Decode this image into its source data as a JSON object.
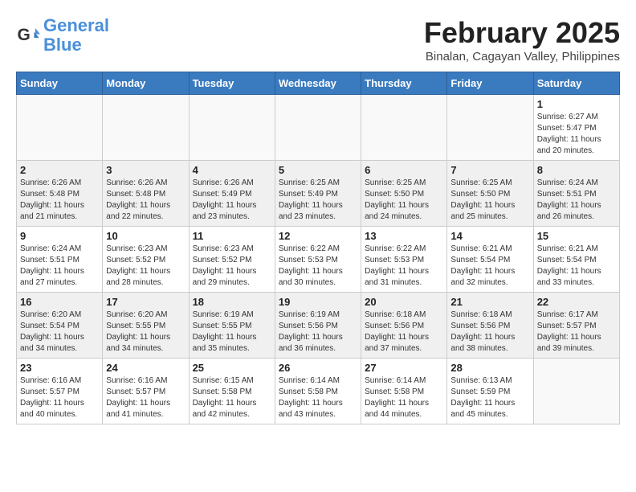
{
  "header": {
    "logo_line1": "General",
    "logo_line2": "Blue",
    "month_title": "February 2025",
    "location": "Binalan, Cagayan Valley, Philippines"
  },
  "days_of_week": [
    "Sunday",
    "Monday",
    "Tuesday",
    "Wednesday",
    "Thursday",
    "Friday",
    "Saturday"
  ],
  "weeks": [
    [
      {
        "day": "",
        "info": ""
      },
      {
        "day": "",
        "info": ""
      },
      {
        "day": "",
        "info": ""
      },
      {
        "day": "",
        "info": ""
      },
      {
        "day": "",
        "info": ""
      },
      {
        "day": "",
        "info": ""
      },
      {
        "day": "1",
        "info": "Sunrise: 6:27 AM\nSunset: 5:47 PM\nDaylight: 11 hours\nand 20 minutes."
      }
    ],
    [
      {
        "day": "2",
        "info": "Sunrise: 6:26 AM\nSunset: 5:48 PM\nDaylight: 11 hours\nand 21 minutes."
      },
      {
        "day": "3",
        "info": "Sunrise: 6:26 AM\nSunset: 5:48 PM\nDaylight: 11 hours\nand 22 minutes."
      },
      {
        "day": "4",
        "info": "Sunrise: 6:26 AM\nSunset: 5:49 PM\nDaylight: 11 hours\nand 23 minutes."
      },
      {
        "day": "5",
        "info": "Sunrise: 6:25 AM\nSunset: 5:49 PM\nDaylight: 11 hours\nand 23 minutes."
      },
      {
        "day": "6",
        "info": "Sunrise: 6:25 AM\nSunset: 5:50 PM\nDaylight: 11 hours\nand 24 minutes."
      },
      {
        "day": "7",
        "info": "Sunrise: 6:25 AM\nSunset: 5:50 PM\nDaylight: 11 hours\nand 25 minutes."
      },
      {
        "day": "8",
        "info": "Sunrise: 6:24 AM\nSunset: 5:51 PM\nDaylight: 11 hours\nand 26 minutes."
      }
    ],
    [
      {
        "day": "9",
        "info": "Sunrise: 6:24 AM\nSunset: 5:51 PM\nDaylight: 11 hours\nand 27 minutes."
      },
      {
        "day": "10",
        "info": "Sunrise: 6:23 AM\nSunset: 5:52 PM\nDaylight: 11 hours\nand 28 minutes."
      },
      {
        "day": "11",
        "info": "Sunrise: 6:23 AM\nSunset: 5:52 PM\nDaylight: 11 hours\nand 29 minutes."
      },
      {
        "day": "12",
        "info": "Sunrise: 6:22 AM\nSunset: 5:53 PM\nDaylight: 11 hours\nand 30 minutes."
      },
      {
        "day": "13",
        "info": "Sunrise: 6:22 AM\nSunset: 5:53 PM\nDaylight: 11 hours\nand 31 minutes."
      },
      {
        "day": "14",
        "info": "Sunrise: 6:21 AM\nSunset: 5:54 PM\nDaylight: 11 hours\nand 32 minutes."
      },
      {
        "day": "15",
        "info": "Sunrise: 6:21 AM\nSunset: 5:54 PM\nDaylight: 11 hours\nand 33 minutes."
      }
    ],
    [
      {
        "day": "16",
        "info": "Sunrise: 6:20 AM\nSunset: 5:54 PM\nDaylight: 11 hours\nand 34 minutes."
      },
      {
        "day": "17",
        "info": "Sunrise: 6:20 AM\nSunset: 5:55 PM\nDaylight: 11 hours\nand 34 minutes."
      },
      {
        "day": "18",
        "info": "Sunrise: 6:19 AM\nSunset: 5:55 PM\nDaylight: 11 hours\nand 35 minutes."
      },
      {
        "day": "19",
        "info": "Sunrise: 6:19 AM\nSunset: 5:56 PM\nDaylight: 11 hours\nand 36 minutes."
      },
      {
        "day": "20",
        "info": "Sunrise: 6:18 AM\nSunset: 5:56 PM\nDaylight: 11 hours\nand 37 minutes."
      },
      {
        "day": "21",
        "info": "Sunrise: 6:18 AM\nSunset: 5:56 PM\nDaylight: 11 hours\nand 38 minutes."
      },
      {
        "day": "22",
        "info": "Sunrise: 6:17 AM\nSunset: 5:57 PM\nDaylight: 11 hours\nand 39 minutes."
      }
    ],
    [
      {
        "day": "23",
        "info": "Sunrise: 6:16 AM\nSunset: 5:57 PM\nDaylight: 11 hours\nand 40 minutes."
      },
      {
        "day": "24",
        "info": "Sunrise: 6:16 AM\nSunset: 5:57 PM\nDaylight: 11 hours\nand 41 minutes."
      },
      {
        "day": "25",
        "info": "Sunrise: 6:15 AM\nSunset: 5:58 PM\nDaylight: 11 hours\nand 42 minutes."
      },
      {
        "day": "26",
        "info": "Sunrise: 6:14 AM\nSunset: 5:58 PM\nDaylight: 11 hours\nand 43 minutes."
      },
      {
        "day": "27",
        "info": "Sunrise: 6:14 AM\nSunset: 5:58 PM\nDaylight: 11 hours\nand 44 minutes."
      },
      {
        "day": "28",
        "info": "Sunrise: 6:13 AM\nSunset: 5:59 PM\nDaylight: 11 hours\nand 45 minutes."
      },
      {
        "day": "",
        "info": ""
      }
    ]
  ]
}
